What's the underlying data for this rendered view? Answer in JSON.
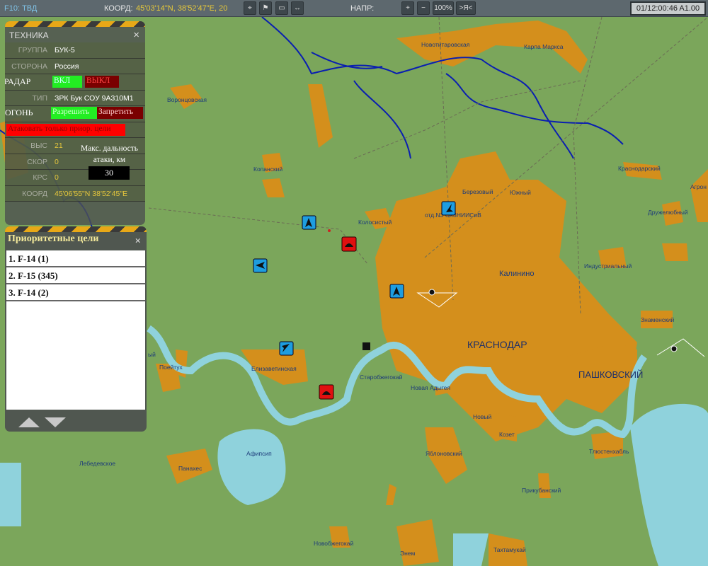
{
  "topbar": {
    "mode": "F10: ТВД",
    "coord_label": "КООРД:",
    "coord_value": "45'03'14\"N, 38'52'47\"E, 20",
    "heading_label": "НАПР:",
    "zoom_in": "+",
    "zoom_out": "−",
    "zoom_level": "100%",
    "center_button": ">Я<",
    "clock": "01/12:00:46 A1.00"
  },
  "unit_panel": {
    "title": "ТЕХНИКА",
    "close": "×",
    "group_label": "ГРУППА",
    "group_value": "БУК-5",
    "side_label": "СТОРОНА",
    "side_value": "Россия",
    "radar_label": "РАДАР",
    "radar_on": "ВКЛ",
    "radar_off": "ВЫКЛ",
    "type_label": "ТИП",
    "type_value": "ЗРК Бук СОУ 9А310М1",
    "fire_label": "ОГОНЬ",
    "fire_allow": "Разрешить",
    "fire_deny": "Запретить",
    "priority_only": "Атаковать только приор. цели",
    "alt_label": "ВЫС",
    "alt_value": "21",
    "speed_label": "СКОР",
    "speed_value": "0",
    "heading_label": "КРС",
    "heading_value": "0",
    "range_label": "Макс. дальность атаки, км",
    "range_value": "30",
    "coord_label": "КООРД",
    "coord_value": "45'06'55\"N  38'52'45\"E"
  },
  "priority_panel": {
    "title": "Приоритетные цели",
    "close": "×",
    "items": [
      "1. F-14 (1)",
      "2. F-15 (345)",
      "3. F-14 (2)"
    ]
  },
  "colors": {
    "land": "#7ba65b",
    "urban": "#d48f1c",
    "water": "#8fd2dc",
    "river": "#0a1fb0",
    "enemy": "#e01010",
    "friendly_air": "#1e9de0"
  },
  "map": {
    "labels": [
      "Новотитаровская",
      "Карпа Маркса",
      "Воронцовская",
      "Копанский",
      "Краснодарский",
      "Агрон",
      "Березовый",
      "Южный",
      "Дружелюбный",
      "отд.N3 СКЗНИИСиВ",
      "Колосистый",
      "Индустриальный",
      "Калинино",
      "Знаменский",
      "КРАСНОДАР",
      "ПАШКОВСКИЙ",
      "Поейтух",
      "Елизаветинская",
      "Старобжегокай",
      "Новая Адыгея",
      "Новый",
      "Козет",
      "Яблоновский",
      "Тлюстенхабль",
      "Афипсип",
      "Панахес",
      "Прикубанский",
      "Новобжегокай",
      "Энем",
      "Тахтамукай",
      "Лебедевское",
      "ый"
    ]
  }
}
